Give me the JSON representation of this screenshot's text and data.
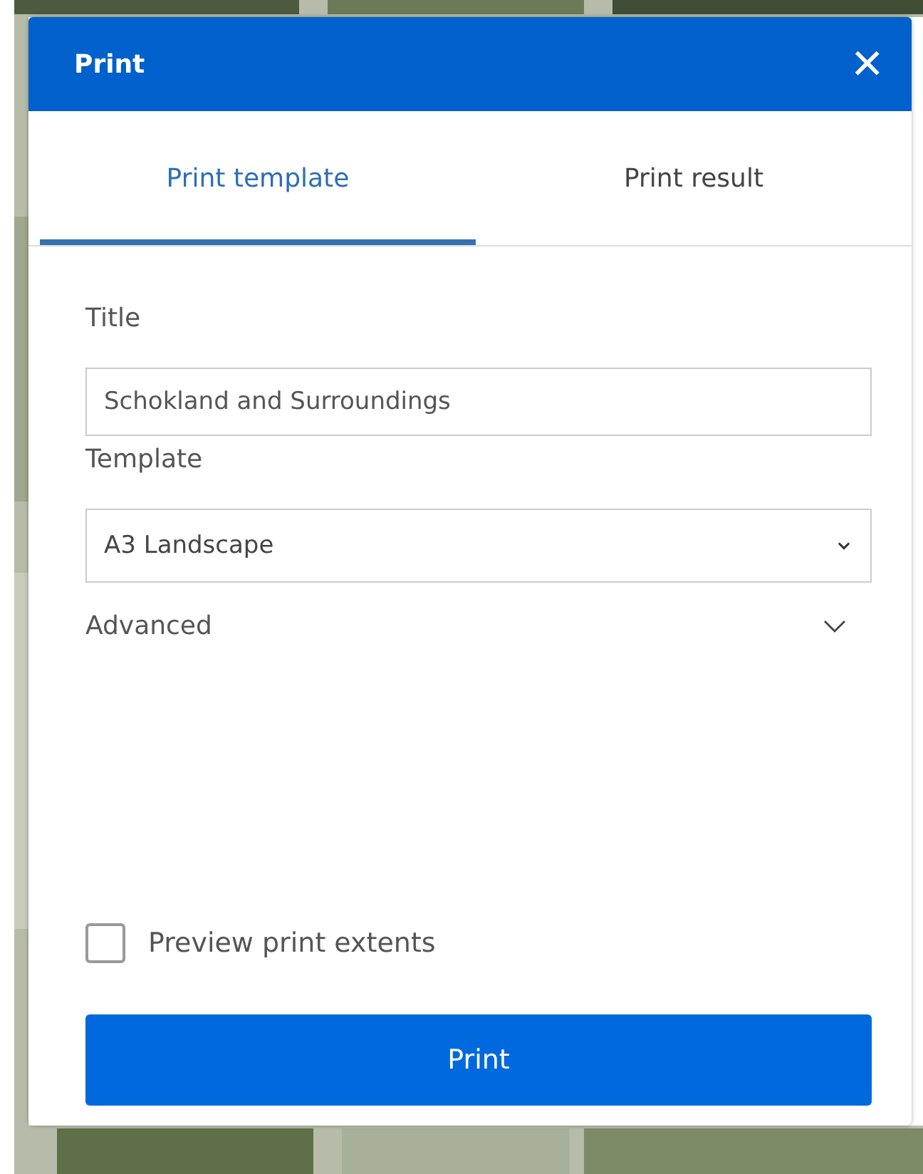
{
  "window": {
    "title": "Print",
    "close": "×"
  },
  "tabs": [
    {
      "label": "Print template",
      "selected": true
    },
    {
      "label": "Print result",
      "selected": false
    }
  ],
  "title_field": {
    "label": "Title",
    "value": "Schokland and Surroundings"
  },
  "template_field": {
    "label": "Template",
    "value": "A3 Landscape"
  },
  "advanced": {
    "label": "Advanced",
    "expanded": false
  },
  "preview": {
    "label": "Preview print extents",
    "checked": false
  },
  "print_button": "Print"
}
